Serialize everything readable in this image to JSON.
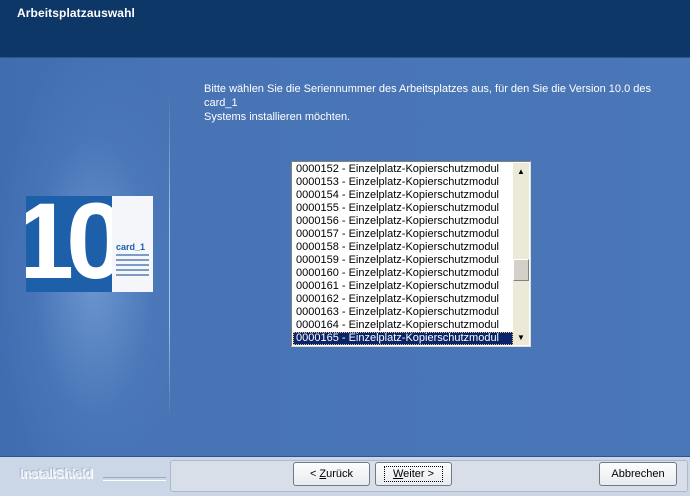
{
  "header": {
    "title": "Arbeitsplatzauswahl"
  },
  "instruction": {
    "line1": "Bitte wählen Sie die Seriennummer des Arbeitsplatzes aus, für den Sie die Version 10.0 des card_1",
    "line2": "Systems installieren möchten."
  },
  "logo": {
    "number": "10",
    "brand": "card_1"
  },
  "list": {
    "items": [
      "0000152 - Einzelplatz-Kopierschutzmodul",
      "0000153 - Einzelplatz-Kopierschutzmodul",
      "0000154 - Einzelplatz-Kopierschutzmodul",
      "0000155 - Einzelplatz-Kopierschutzmodul",
      "0000156 - Einzelplatz-Kopierschutzmodul",
      "0000157 - Einzelplatz-Kopierschutzmodul",
      "0000158 - Einzelplatz-Kopierschutzmodul",
      "0000159 - Einzelplatz-Kopierschutzmodul",
      "0000160 - Einzelplatz-Kopierschutzmodul",
      "0000161 - Einzelplatz-Kopierschutzmodul",
      "0000162 - Einzelplatz-Kopierschutzmodul",
      "0000163 - Einzelplatz-Kopierschutzmodul",
      "0000164 - Einzelplatz-Kopierschutzmodul",
      "0000165 - Einzelplatz-Kopierschutzmodul"
    ],
    "selected_index": 13
  },
  "footer": {
    "brand": "InstallShield",
    "back_prefix": "< ",
    "back_accel": "Z",
    "back_rest": "urück",
    "next_accel": "W",
    "next_rest": "eiter >",
    "cancel_label": "Abbrechen"
  },
  "colors": {
    "header_bg": "#0d3766",
    "main_bg": "#4a77b8",
    "selection": "#0a246a",
    "footer_bg": "#cbd7e6"
  },
  "icons": {
    "scroll_up": "triangle-up-icon",
    "scroll_down": "triangle-down-icon"
  }
}
